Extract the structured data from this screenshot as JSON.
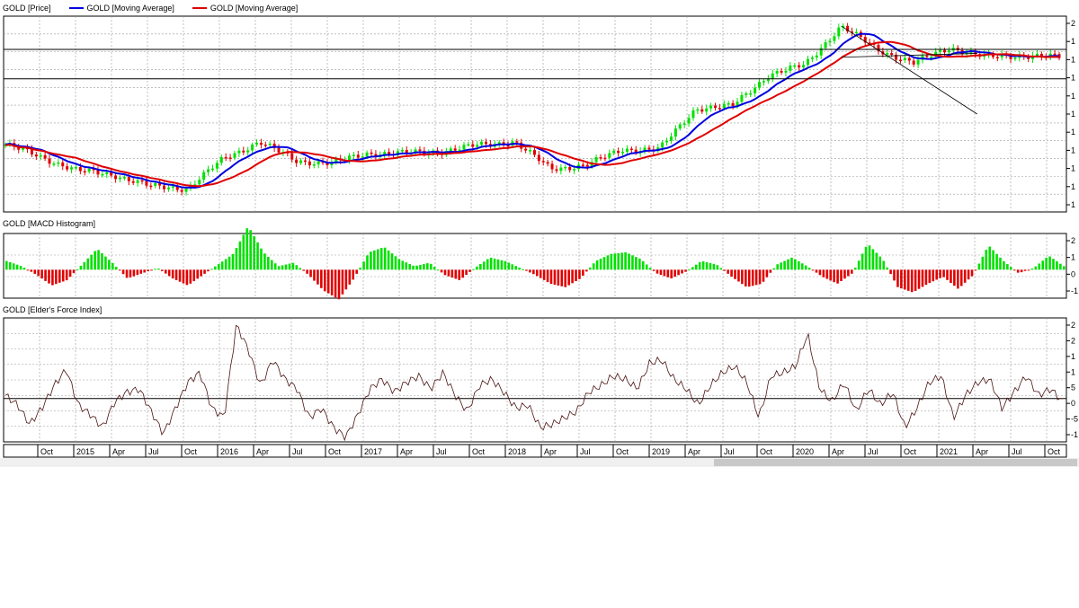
{
  "legend": {
    "series": [
      {
        "label": "GOLD [Price]",
        "color": null
      },
      {
        "label": "GOLD [Moving Average]",
        "color": "#0000e0"
      },
      {
        "label": "GOLD [Moving Average]",
        "color": "#e00000"
      }
    ]
  },
  "panels": {
    "macd_title": "GOLD [MACD Histogram]",
    "force_title": "GOLD [Elder's Force Index]"
  },
  "colors": {
    "up": "#00e000",
    "down": "#e00000",
    "ma_fast": "#0000e0",
    "ma_slow": "#e00000",
    "force_line": "#4b1414",
    "grid": "#9a9a9a"
  },
  "chart_data": [
    {
      "type": "line",
      "title": "GOLD [Price]",
      "x_axis_labels": [
        "Oct",
        "2015",
        "Apr",
        "Jul",
        "Oct",
        "2016",
        "Apr",
        "Jul",
        "Oct",
        "2017",
        "Apr",
        "Jul",
        "Oct",
        "2018",
        "Apr",
        "Jul",
        "Oct",
        "2019",
        "Apr",
        "Jul",
        "Oct",
        "2020",
        "Apr",
        "Jul",
        "Oct",
        "2021",
        "Apr",
        "Jul",
        "Oct"
      ],
      "y_tick_labels": [
        "2",
        "1",
        "1",
        "1",
        "1",
        "1",
        "1",
        "1",
        "1",
        "1",
        "1"
      ],
      "points": [
        {
          "x": "Oct 2014",
          "y": 0.345
        },
        {
          "x": "2015",
          "y": 0.28
        },
        {
          "x": "Apr 2015",
          "y": 0.21
        },
        {
          "x": "Jul 2015",
          "y": 0.19
        },
        {
          "x": "Oct 2015",
          "y": 0.13
        },
        {
          "x": "2016",
          "y": 0.12
        },
        {
          "x": "Apr 2016",
          "y": 0.27
        },
        {
          "x": "Jul 2016",
          "y": 0.36
        },
        {
          "x": "Oct 2016",
          "y": 0.26
        },
        {
          "x": "2017",
          "y": 0.25
        },
        {
          "x": "Apr 2017",
          "y": 0.3
        },
        {
          "x": "Jul 2017",
          "y": 0.3
        },
        {
          "x": "Oct 2017",
          "y": 0.31
        },
        {
          "x": "2018",
          "y": 0.34
        },
        {
          "x": "Apr 2018",
          "y": 0.36
        },
        {
          "x": "Jul 2018",
          "y": 0.22
        },
        {
          "x": "Oct 2018",
          "y": 0.24
        },
        {
          "x": "2019",
          "y": 0.32
        },
        {
          "x": "Apr 2019",
          "y": 0.32
        },
        {
          "x": "Jul 2019",
          "y": 0.53
        },
        {
          "x": "Oct 2019",
          "y": 0.54
        },
        {
          "x": "2020",
          "y": 0.7
        },
        {
          "x": "Apr 2020",
          "y": 0.75
        },
        {
          "x": "Jul 2020",
          "y": 0.95
        },
        {
          "x": "Oct 2020",
          "y": 0.83
        },
        {
          "x": "2021",
          "y": 0.76
        },
        {
          "x": "Apr 2021",
          "y": 0.84
        },
        {
          "x": "Jul 2021",
          "y": 0.79
        },
        {
          "x": "Oct 2021",
          "y": 0.8
        },
        {
          "x": "Dec 2021",
          "y": 0.79
        }
      ],
      "horizontal_lines": [
        0.83,
        0.68
      ],
      "trendlines": [
        {
          "from": {
            "x": "Jul 2020",
            "y": 0.95
          },
          "to": {
            "x": "Apr 2021",
            "y": 0.53
          }
        },
        {
          "from": {
            "x": "Jul 2020",
            "y": 0.79
          },
          "to": {
            "x": "Apr 2021",
            "y": 0.84
          }
        }
      ],
      "grid": true
    },
    {
      "type": "bar",
      "title": "GOLD [MACD Histogram]",
      "y_tick_labels": [
        "2",
        "1",
        "0",
        "-1"
      ],
      "values": [
        0.5,
        0.2,
        -0.3,
        -0.9,
        -0.6,
        0.3,
        1.2,
        0.4,
        -0.5,
        -0.2,
        0.1,
        -0.5,
        -0.9,
        -0.3,
        0.3,
        0.9,
        2.5,
        1.0,
        0.2,
        0.4,
        -0.3,
        -1.2,
        -1.7,
        -0.5,
        1.0,
        1.3,
        0.6,
        0.2,
        0.4,
        -0.3,
        -0.6,
        0.1,
        0.7,
        0.5,
        0.1,
        -0.3,
        -0.8,
        -1.0,
        -0.5,
        0.5,
        0.9,
        1.0,
        0.6,
        -0.2,
        -0.5,
        -0.1,
        0.5,
        0.3,
        -0.4,
        -1.0,
        -0.8,
        0.3,
        0.7,
        0.2,
        -0.4,
        -0.8,
        -0.2,
        1.5,
        0.6,
        -1.0,
        -1.3,
        -0.8,
        -0.4,
        -1.1,
        -0.3,
        1.4,
        0.5,
        -0.2,
        0.1,
        0.8,
        0.2
      ],
      "grid": true
    },
    {
      "type": "line",
      "title": "GOLD [Elder's Force Index]",
      "y_tick_labels": [
        "2",
        "2",
        "1",
        "1",
        "5",
        "0",
        "-5",
        "-1"
      ],
      "values": [
        0.1,
        -0.2,
        -0.8,
        -0.3,
        0.4,
        0.9,
        -0.2,
        -0.5,
        -0.9,
        -0.1,
        0.2,
        0.3,
        -0.4,
        -1.1,
        -0.3,
        0.5,
        0.8,
        -0.3,
        -0.6,
        2.3,
        1.5,
        0.4,
        1.2,
        0.6,
        0.3,
        -0.6,
        -0.3,
        -0.9,
        -1.2,
        -0.5,
        0.3,
        0.6,
        0.2,
        0.5,
        0.7,
        0.3,
        0.8,
        0.1,
        -0.4,
        0.4,
        0.6,
        0.2,
        -0.3,
        -0.2,
        -0.9,
        -0.8,
        -0.6,
        -0.4,
        0.2,
        0.4,
        0.7,
        0.6,
        0.3,
        1.1,
        1.2,
        0.6,
        0.3,
        -0.2,
        0.4,
        0.8,
        1.0,
        0.5,
        -0.6,
        0.7,
        0.8,
        1.0,
        2.0,
        0.3,
        -0.1,
        0.5,
        -0.4,
        0.3,
        -0.2,
        0.2,
        -0.9,
        -0.3,
        0.5,
        0.7,
        -0.6,
        0.1,
        0.5,
        0.6,
        -0.3,
        0.2,
        0.7,
        0.1,
        0.3,
        -0.1
      ],
      "zero_line": true,
      "grid": true
    }
  ]
}
